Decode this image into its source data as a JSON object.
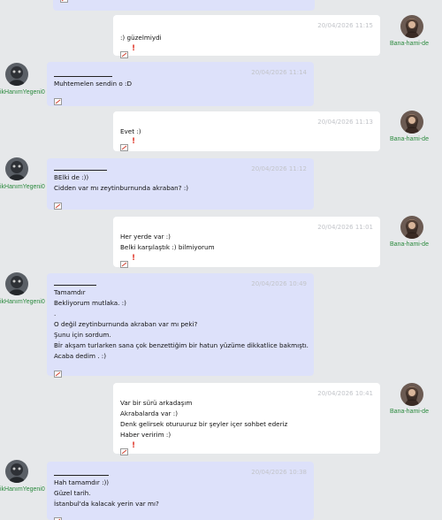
{
  "colors": {
    "background": "#e6e8ea",
    "outgoing_bubble": "#ffffff",
    "incoming_bubble": "#dde1fa",
    "timestamp": "#c2c4c9",
    "username": "#2b8a3e",
    "flag": "#e03b2e"
  },
  "users": {
    "me": "Bana-hami-de",
    "them": "ikHanımYegeni0"
  },
  "messages": [
    {
      "timestamp": "20/04/2026 11:15",
      "lines": [
        ":) güzelmiydi"
      ]
    },
    {
      "timestamp": "20/04/2026 11:14",
      "lines": [
        "Muhtemelen sendin o :D"
      ]
    },
    {
      "timestamp": "20/04/2026 11:13",
      "lines": [
        "Evet :)"
      ]
    },
    {
      "timestamp": "20/04/2026 11:12",
      "lines": [
        "BElki de :))",
        "Cidden var mı zeytinburnunda akraban? :)"
      ]
    },
    {
      "timestamp": "20/04/2026 11:01",
      "lines": [
        "Her yerde var :)",
        "Belki karşılaştık :) bilmiyorum"
      ]
    },
    {
      "timestamp": "20/04/2026 10:49",
      "lines": [
        "Tamamdır",
        "Bekliyorum mutlaka. :)",
        ".",
        "O değil zeytinburnunda akraban var mı peki?",
        "Şunu için sordum.",
        "Bİr akşam turlarken sana çok benzettiğim bir hatun yüzüme dikkatlice bakmıştı.",
        "Acaba dedim . :)"
      ]
    },
    {
      "timestamp": "20/04/2026 10:41",
      "lines": [
        "Var bir sürü arkadaşım",
        "Akrabalarda var :)",
        "Denk gelirsek oturuuruz bir şeyler içer sohbet ederiz",
        "Haber veririm :)"
      ]
    },
    {
      "timestamp": "20/04/2026 10:38",
      "lines": [
        "Hah tamamdır :))",
        "Güzel tarih.",
        "İstanbul'da kalacak yerin var mı?"
      ]
    }
  ],
  "icons": {
    "edit": "edit-icon",
    "report": "report-flag-icon",
    "avatar_me": "avatar-icon",
    "avatar_them": "avatar-icon"
  },
  "flag_glyph": "!"
}
